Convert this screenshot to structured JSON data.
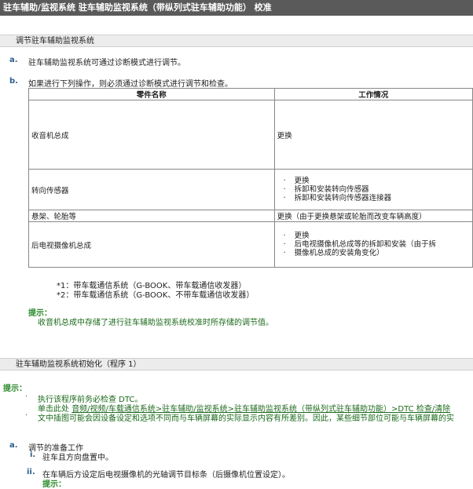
{
  "title": "驻车辅助/监视系统  驻车辅助监视系统（带纵列式驻车辅助功能）  校准",
  "section1": {
    "heading": "调节驻车辅助监视系统",
    "item_a_letter": "a.",
    "item_a_text": "驻车辅助监视系统可通过诊断模式进行调节。",
    "item_b_letter": "b.",
    "item_b_text": "如果进行下列操作，则必须通过诊断模式进行调节和检查。",
    "table": {
      "headers": [
        "零件名称",
        "工作情况"
      ],
      "rows": [
        {
          "part": "收音机总成",
          "work": [
            "更换"
          ],
          "plain": true
        },
        {
          "part": "转向传感器",
          "work": [
            "更换",
            "拆卸和安装转向传感器",
            "拆卸和安装转向传感器连接器"
          ],
          "plain": false
        },
        {
          "part": "悬架、轮胎等",
          "work": [
            "更换（由于更换悬架或轮胎而改变车辆高度）"
          ],
          "plain": true
        },
        {
          "part": "后电视摄像机总成",
          "work": [
            "更换",
            "后电视摄像机总成等的拆卸和安装（由于拆",
            "摄像机总成的安装角变化）"
          ],
          "plain": false
        }
      ]
    },
    "note1": "*1：带车载通信系统（G-BOOK、带车载通信收发器）",
    "note2": "*2：带车载通信系统（G-BOOK、不带车载通信收发器）",
    "hint_label": "提示：",
    "hint_text": "收音机总成中存储了进行驻车辅助监视系统校准时所存储的调节值。"
  },
  "section2": {
    "heading": "驻车辅助监视系统初始化（程序 1）",
    "hint_label": "提示：",
    "bullet1": "执行该程序前务必检查 DTC。",
    "link_prefix": "单击此处 ",
    "link_text": "音频/视频/车载通信系统>驻车辅助/监视系统>驻车辅助监视系统（带纵列式驻车辅助功能）>DTC 检查/清除",
    "bullet2": "文中插图可能会因设备设定和选项不同而与车辆屏幕的实际显示内容有所差别。因此，某些细节部位可能与车辆屏幕的实",
    "item_a_letter": "a.",
    "item_a_text": "调节的准备工作",
    "step_i_num": "i.",
    "step_i_text": "驻车且方向盘置中。",
    "step_ii_num": "ii.",
    "step_ii_text": "在车辆后方设定后电视摄像机的光轴调节目标条（后摄像机位置设定）。",
    "sub_hint_label": "提示："
  }
}
